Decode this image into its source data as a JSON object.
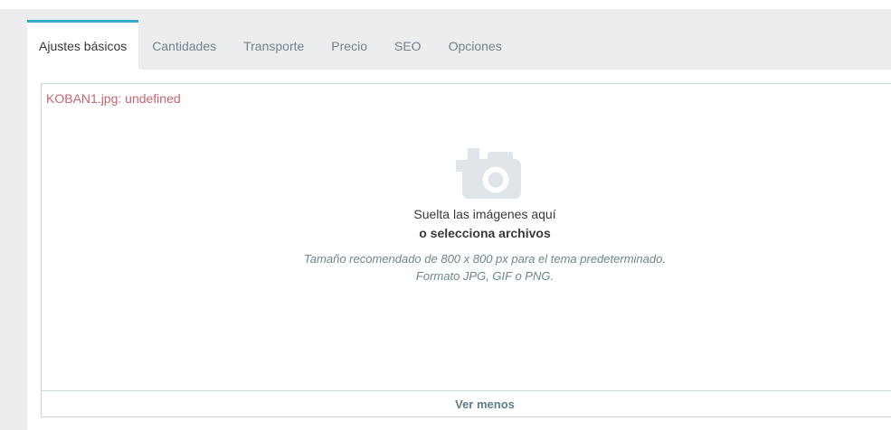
{
  "tabs": [
    {
      "label": "Ajustes básicos",
      "active": true
    },
    {
      "label": "Cantidades",
      "active": false
    },
    {
      "label": "Transporte",
      "active": false
    },
    {
      "label": "Precio",
      "active": false
    },
    {
      "label": "SEO",
      "active": false
    },
    {
      "label": "Opciones",
      "active": false
    }
  ],
  "dropzone": {
    "error_message": "KOBAN1.jpg: undefined",
    "drop_text": "Suelta las imágenes aquí",
    "select_text": "o selecciona archivos",
    "size_hint": "Tamaño recomendado de 800 x 800 px para el tema predeterminado.",
    "format_hint": "Formato JPG, GIF o PNG.",
    "footer_button": "Ver menos",
    "icon": "add-photo-icon"
  },
  "colors": {
    "accent": "#35a9c7",
    "error-text": "#c7656d",
    "tab-bar-bg": "#ebedee",
    "panel-border": "#ccd7db",
    "text-dark": "#363a41",
    "text-muted": "#6c868e",
    "tab-inactive": "#75838c",
    "footer-link": "#5f7d8a",
    "icon-gray": "#dfe5e8"
  }
}
